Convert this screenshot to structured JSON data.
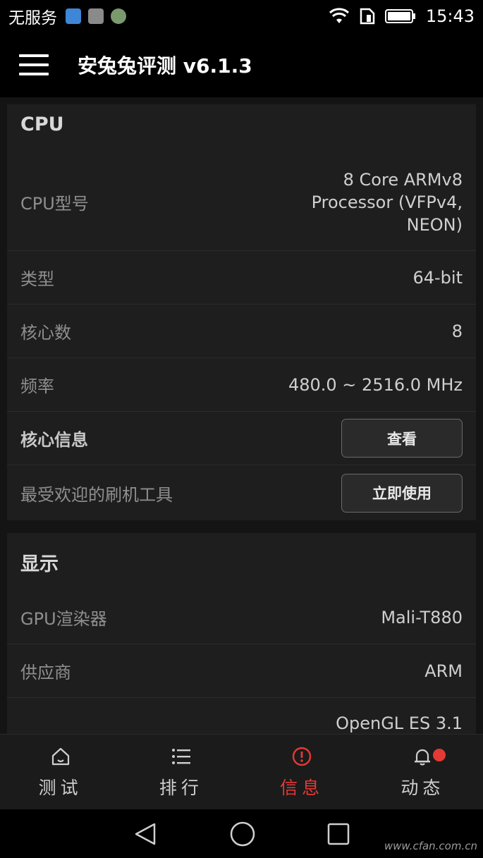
{
  "status_bar": {
    "carrier": "无服务",
    "time": "15:43",
    "icons": [
      "heart-app-icon",
      "gallery-app-icon",
      "flower-app-icon",
      "wifi-icon",
      "sim-icon",
      "battery-icon"
    ]
  },
  "app_bar": {
    "title": "安兔兔评测 v6.1.3",
    "menu_icon": "hamburger-icon"
  },
  "cpu": {
    "title": "CPU",
    "rows": [
      {
        "label": "CPU型号",
        "value": "8 Core ARMv8 Processor (VFPv4, NEON)"
      },
      {
        "label": "类型",
        "value": "64-bit"
      },
      {
        "label": "核心数",
        "value": "8"
      },
      {
        "label": "频率",
        "value": "480.0 ~ 2516.0 MHz"
      }
    ],
    "core_info": {
      "label": "核心信息",
      "button": "查看"
    },
    "flash_tool": {
      "label": "最受欢迎的刷机工具",
      "button": "立即使用"
    }
  },
  "display": {
    "title": "显示",
    "rows": [
      {
        "label": "GPU渲染器",
        "value": "Mali-T880"
      },
      {
        "label": "供应商",
        "value": "ARM"
      },
      {
        "label": "",
        "value": "OpenGL ES 3.1"
      }
    ]
  },
  "bottom_nav": {
    "items": [
      {
        "label": "测试",
        "icon": "home-icon"
      },
      {
        "label": "排行",
        "icon": "list-icon"
      },
      {
        "label": "信息",
        "icon": "info-alert-icon"
      },
      {
        "label": "动态",
        "icon": "bell-icon"
      }
    ],
    "active_index": 2
  },
  "colors": {
    "accent": "#e53935",
    "background": "#141414",
    "card": "#1e1e1e"
  },
  "watermark": "www.cfan.com.cn"
}
